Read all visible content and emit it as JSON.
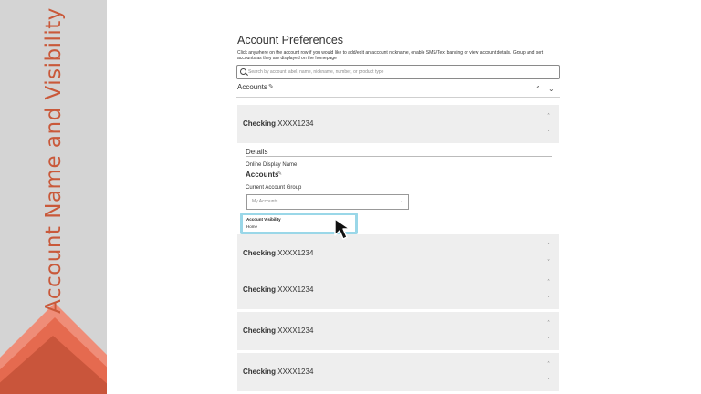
{
  "sidebar": {
    "title": "Account Name and Visibility"
  },
  "main": {
    "title": "Account Preferences",
    "description": "Click anywhere on the account row if you would like to add/edit an account nickname, enable SMS/Text banking or view account details. Group and sort accounts as they are displayed on the homepage",
    "search": {
      "placeholder": "Search by account label, name, nickname, number, or product type",
      "value": ""
    },
    "accounts_header": "Accounts",
    "rows": [
      {
        "type": "Checking",
        "number": "XXXX1234"
      },
      {
        "type": "Checking",
        "number": "XXXX1234"
      },
      {
        "type": "Checking",
        "number": "XXXX1234"
      },
      {
        "type": "Checking",
        "number": "XXXX1234"
      },
      {
        "type": "Checking",
        "number": "XXXX1234"
      }
    ],
    "details": {
      "title": "Details",
      "online_display_name_label": "Online Display Name",
      "online_display_name_value": "Accounts",
      "account_group_label": "Current Account Group",
      "account_group_value": "My Accounts",
      "visibility_label": "Account Visibility",
      "visibility_value": "Home"
    }
  },
  "colors": {
    "accent": "#c9593a",
    "highlight": "#9ad7e8"
  },
  "icons": {
    "search": "search-icon",
    "edit": "pencil-icon",
    "expand": "chevron-down-icon",
    "collapse": "chevron-up-icon",
    "cursor": "mouse-pointer-icon"
  }
}
